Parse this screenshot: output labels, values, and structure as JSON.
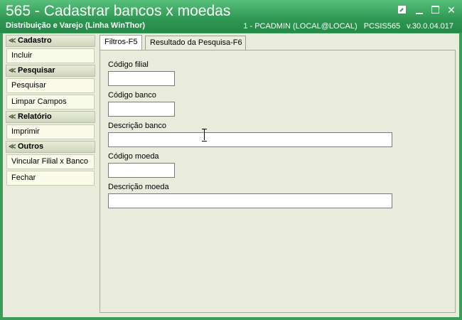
{
  "window": {
    "title": "565 - Cadastrar bancos x moedas",
    "subtitle": "Distribuição e Varejo (Linha WinThor)",
    "user_info": "1 - PCADMIN (LOCAL@LOCAL)",
    "routine": "PCSIS565",
    "version": "v.30.0.04.017",
    "close_glyph": "✕"
  },
  "sidebar": {
    "groups": [
      {
        "title": "Cadastro",
        "items": [
          "Incluir"
        ]
      },
      {
        "title": "Pesquisar",
        "items": [
          "Pesquisar",
          "Limpar Campos"
        ]
      },
      {
        "title": "Relatório",
        "items": [
          "Imprimir"
        ]
      },
      {
        "title": "Outros",
        "items": [
          "Vincular Filial x Banco",
          "Fechar"
        ]
      }
    ]
  },
  "tabs": [
    "Filtros-F5",
    "Resultado da Pesquisa-F6"
  ],
  "form": {
    "codigo_filial": {
      "label": "Código filial",
      "value": ""
    },
    "codigo_banco": {
      "label": "Código banco",
      "value": ""
    },
    "descricao_banco": {
      "label": "Descrição banco",
      "value": ""
    },
    "codigo_moeda": {
      "label": "Código moeda",
      "value": ""
    },
    "descricao_moeda": {
      "label": "Descrição moeda",
      "value": ""
    }
  },
  "colors": {
    "titlebar": "#2d9652",
    "panel_bg": "#e9ecdc"
  }
}
